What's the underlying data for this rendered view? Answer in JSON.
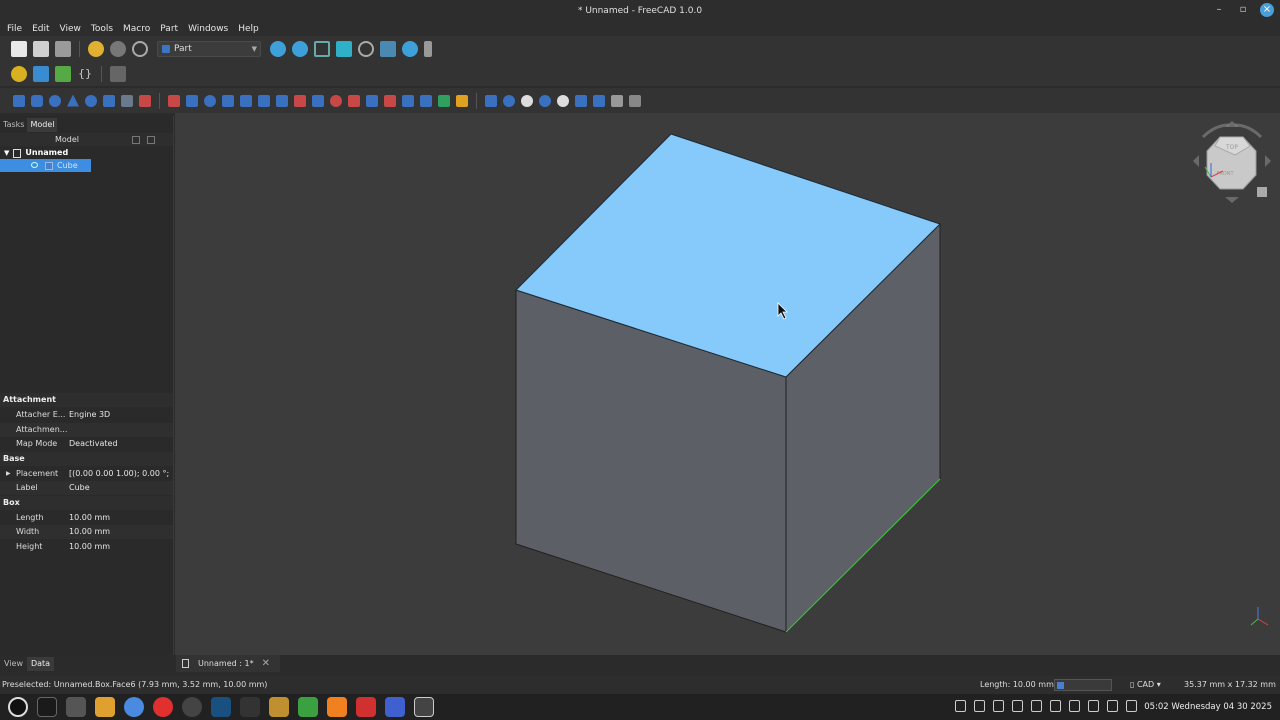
{
  "window": {
    "title": "* Unnamed - FreeCAD 1.0.0",
    "minimize": "–",
    "maximize": "▫",
    "close": "×"
  },
  "menu": [
    "File",
    "Edit",
    "View",
    "Tools",
    "Macro",
    "Part",
    "Windows",
    "Help"
  ],
  "toolbar": {
    "workbench": "Part"
  },
  "combo": {
    "tabs": [
      "Tasks",
      "Model"
    ]
  },
  "tree": {
    "header": "Model",
    "root": "Unnamed",
    "item": "Cube"
  },
  "properties": {
    "groups": [
      {
        "name": "Attachment",
        "rows": [
          {
            "key": "Attacher E...",
            "value": "Engine 3D"
          },
          {
            "key": "Attachmen...",
            "value": ""
          },
          {
            "key": "Map Mode",
            "value": "Deactivated"
          }
        ]
      },
      {
        "name": "Base",
        "rows": [
          {
            "key": "Placement",
            "value": "[(0.00 0.00 1.00); 0.00 °; (..."
          },
          {
            "key": "Label",
            "value": "Cube"
          }
        ]
      },
      {
        "name": "Box",
        "rows": [
          {
            "key": "Length",
            "value": "10.00 mm"
          },
          {
            "key": "Width",
            "value": "10.00 mm"
          },
          {
            "key": "Height",
            "value": "10.00 mm"
          }
        ]
      }
    ]
  },
  "bottom_tabs": [
    "View",
    "Data"
  ],
  "document_tab": "Unnamed : 1*",
  "status": {
    "message": "Preselected: Unnamed.Box.Face6 (7.93 mm, 3.52 mm, 10.00 mm)",
    "length": "Length: 10.00 mm",
    "nav": "CAD",
    "dimensions": "35.37 mm x 17.32 mm"
  },
  "navcube": {
    "top": "TOP",
    "front": "FRONT"
  },
  "taskbar": {
    "clock": "05:02 Wednesday 04 30 2025"
  },
  "colors": {
    "selected_face": "#86c9fb",
    "side_face": "#5c5f66",
    "viewport_bg": "#3c3c3c",
    "selection": "#3d8ee0",
    "edge_highlight": "#3fc43f"
  }
}
